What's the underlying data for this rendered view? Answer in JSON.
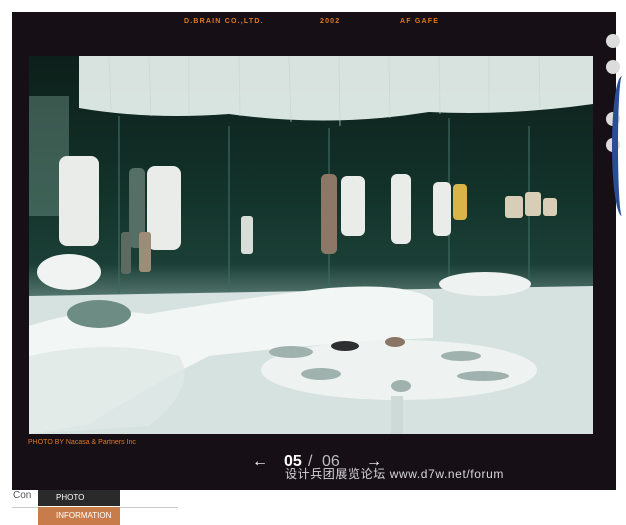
{
  "header": {
    "company": "D.BRAIN CO.,LTD.",
    "year": "2002",
    "project": "AF GAFE"
  },
  "photo": {
    "credit": "PHOTO BY Nacasa & Partners Inc"
  },
  "pager": {
    "prev_icon": "arrow-left-icon",
    "next_icon": "arrow-right-icon",
    "prev_label": "←",
    "next_label": "→",
    "current": "05",
    "separator": "/",
    "total": "06"
  },
  "watermark": "设计兵团展览论坛  www.d7w.net/forum",
  "footer": {
    "partial_text": "Con",
    "tabs": [
      "PHOTO",
      "INFORMATION"
    ]
  },
  "colors": {
    "accent": "#e0781e",
    "frame_bg": "#161016",
    "tab_active_bg": "#c97c4b",
    "tab_bg": "#2a2a2a"
  }
}
